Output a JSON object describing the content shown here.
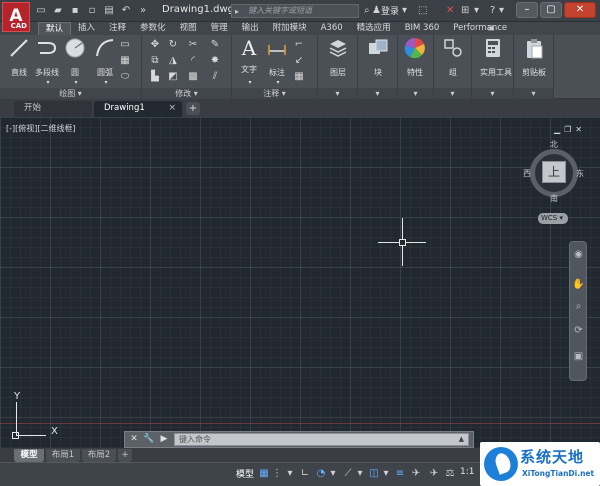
{
  "titlebar": {
    "app_logo": "A",
    "app_logo_suffix": "CAD",
    "doc_title": "Drawing1.dwg",
    "search_placeholder": "键入关键字或短语",
    "signin": "登录"
  },
  "ribbon_tabs": [
    "默认",
    "插入",
    "注释",
    "参数化",
    "视图",
    "管理",
    "输出",
    "附加模块",
    "A360",
    "精选应用",
    "BIM 360",
    "Performance"
  ],
  "ribbon": {
    "draw": {
      "title": "绘图",
      "line": "直线",
      "polyline": "多段线",
      "circle": "圆",
      "arc": "圆弧"
    },
    "modify": {
      "title": "修改"
    },
    "annotation": {
      "title": "注释",
      "text": "文字",
      "dimension": "标注"
    },
    "layers": {
      "title": "图层"
    },
    "block": {
      "title": "块"
    },
    "properties": {
      "title": "特性"
    },
    "groups": {
      "title": "组"
    },
    "utilities": {
      "title": "实用工具"
    },
    "clipboard": {
      "title": "剪贴板"
    }
  },
  "file_tabs": {
    "start": "开始",
    "drawing": "Drawing1"
  },
  "canvas": {
    "viewport_label": "[-][俯视][二维线框]",
    "viewcube": {
      "top": "上",
      "north": "北",
      "south": "南",
      "east": "东",
      "west": "西"
    },
    "wcs": "WCS",
    "ucs_x": "X",
    "ucs_y": "Y"
  },
  "command_line": {
    "placeholder": "键入命令"
  },
  "layout_tabs": [
    "模型",
    "布局1",
    "布局2"
  ],
  "statusbar": {
    "model": "模型",
    "scale": "1:1"
  },
  "watermark": {
    "title": "系统天地",
    "subtitle": "XiTongTianDi.net"
  },
  "colors": {
    "canvas_bg": "#212830",
    "logo_red": "#b5232b",
    "close_red": "#c4432e",
    "status_blue": "#65b1ff"
  }
}
